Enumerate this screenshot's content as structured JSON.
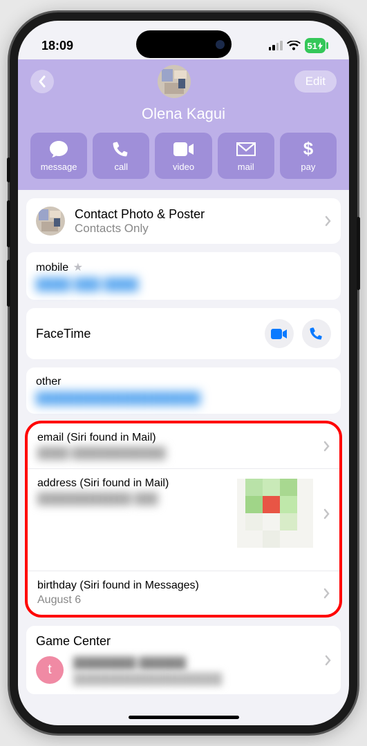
{
  "status": {
    "time": "18:09",
    "battery": "51"
  },
  "header": {
    "edit_label": "Edit",
    "name": "Olena Kagui",
    "actions": {
      "message": "message",
      "call": "call",
      "video": "video",
      "mail": "mail",
      "pay": "pay"
    }
  },
  "contact_photo": {
    "title": "Contact Photo & Poster",
    "sub": "Contacts Only"
  },
  "mobile": {
    "label": "mobile",
    "value": "████ ███ ████"
  },
  "facetime": {
    "label": "FaceTime"
  },
  "other": {
    "label": "other",
    "value": "███████████████████"
  },
  "siri": {
    "email_label": "email (Siri found in Mail)",
    "email_value": "████ ████████████",
    "address_label": "address (Siri found in Mail)",
    "address_value": "████████████ ███",
    "birthday_label": "birthday (Siri found in Messages)",
    "birthday_value": "August 6"
  },
  "gamecenter": {
    "title": "Game Center",
    "initial": "t",
    "line1": "████████ ██████",
    "line2": "███████████████████"
  }
}
